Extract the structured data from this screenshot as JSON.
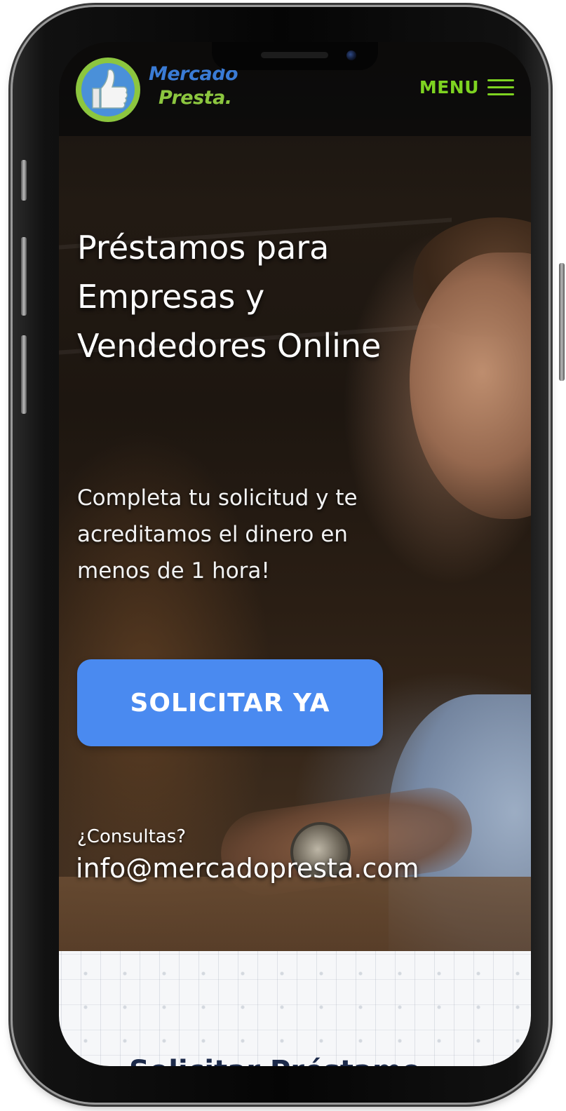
{
  "header": {
    "logo_line1": "Mercado",
    "logo_line2": "Presta.",
    "menu_label": "MENU"
  },
  "hero": {
    "title": "Préstamos para Empresas y Vendedores Online",
    "subtitle": "Completa tu solicitud y te acreditamos el dinero en menos de 1 hora!",
    "cta_label": "SOLICITAR YA",
    "consult_label": "¿Consultas?",
    "consult_email": "info@mercadopresta.com"
  },
  "next_section": {
    "heading": "Solicitar Préstamo"
  },
  "colors": {
    "accent_green": "#7ed321",
    "logo_blue": "#3a7bd5",
    "cta_blue": "#4a8af0"
  },
  "icons": [
    "menu-icon",
    "thumbs-up-icon"
  ]
}
